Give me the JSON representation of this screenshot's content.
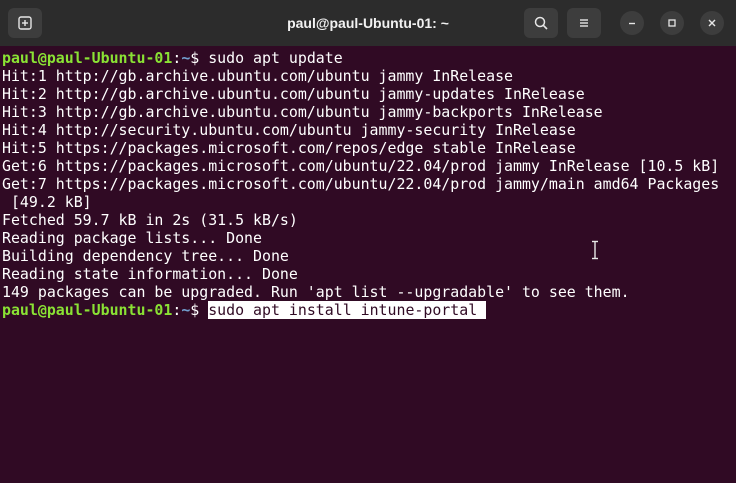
{
  "window": {
    "title": "paul@paul-Ubuntu-01: ~"
  },
  "titlebar": {
    "new_tab_icon": "new-tab-icon",
    "search_icon": "search-icon",
    "menu_icon": "hamburger-menu-icon",
    "minimize_icon": "minimize-icon",
    "maximize_icon": "maximize-icon",
    "close_icon": "close-icon"
  },
  "terminal": {
    "colors": {
      "background": "#300a24",
      "user": "#8ae234",
      "path": "#729fcf",
      "text": "#ffffff"
    },
    "prompt1": {
      "user": "paul@paul-Ubuntu-01",
      "colon": ":",
      "path": "~",
      "dollar": "$ ",
      "command": "sudo apt update"
    },
    "output": [
      "Hit:1 http://gb.archive.ubuntu.com/ubuntu jammy InRelease",
      "Hit:2 http://gb.archive.ubuntu.com/ubuntu jammy-updates InRelease",
      "Hit:3 http://gb.archive.ubuntu.com/ubuntu jammy-backports InRelease",
      "Hit:4 http://security.ubuntu.com/ubuntu jammy-security InRelease",
      "Hit:5 https://packages.microsoft.com/repos/edge stable InRelease",
      "Get:6 https://packages.microsoft.com/ubuntu/22.04/prod jammy InRelease [10.5 kB]",
      "Get:7 https://packages.microsoft.com/ubuntu/22.04/prod jammy/main amd64 Packages",
      " [49.2 kB]",
      "Fetched 59.7 kB in 2s (31.5 kB/s)",
      "Reading package lists... Done",
      "Building dependency tree... Done",
      "Reading state information... Done",
      "149 packages can be upgraded. Run 'apt list --upgradable' to see them."
    ],
    "prompt2": {
      "user": "paul@paul-Ubuntu-01",
      "colon": ":",
      "path": "~",
      "dollar": "$ ",
      "command": "sudo apt install intune-portal "
    }
  }
}
